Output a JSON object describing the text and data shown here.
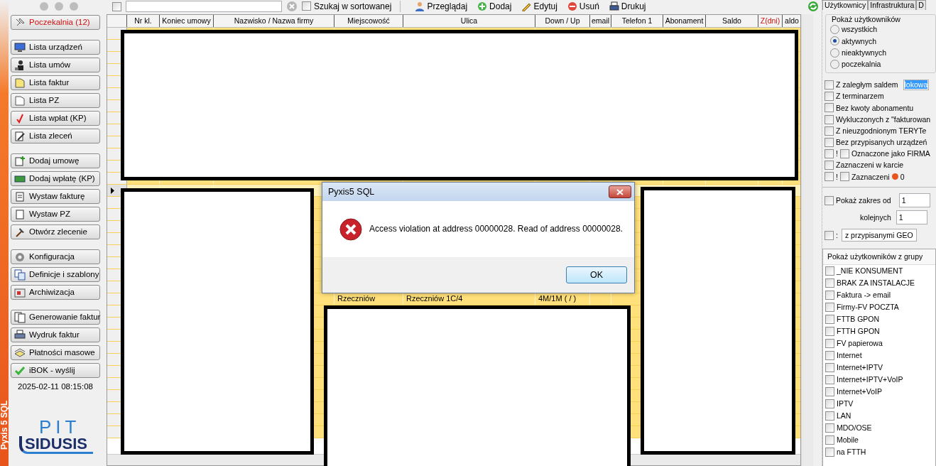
{
  "window": {
    "side_title": "Pyxis 5 SQL"
  },
  "sidebar": {
    "groups": [
      [
        {
          "label": "Poczekalnia (12)",
          "alert": true
        }
      ],
      [
        {
          "label": "Lista urządzeń",
          "alert": false
        },
        {
          "label": "Lista umów",
          "alert": false
        },
        {
          "label": "Lista faktur",
          "alert": false
        },
        {
          "label": "Lista PZ",
          "alert": false
        },
        {
          "label": "Lista wpłat (KP)",
          "alert": false
        },
        {
          "label": "Lista zleceń",
          "alert": false
        }
      ],
      [
        {
          "label": "Dodaj umowę",
          "alert": false
        },
        {
          "label": "Dodaj wpłatę (KP)",
          "alert": false
        },
        {
          "label": "Wystaw fakturę",
          "alert": false
        },
        {
          "label": "Wystaw PZ",
          "alert": false
        },
        {
          "label": "Otwórz zlecenie",
          "alert": false
        }
      ],
      [
        {
          "label": "Konfiguracja",
          "alert": false
        },
        {
          "label": "Definicje i szablony",
          "alert": false
        },
        {
          "label": "Archiwizacja",
          "alert": false
        }
      ],
      [
        {
          "label": "Generowanie faktur",
          "alert": false
        },
        {
          "label": "Wydruk faktur",
          "alert": false
        },
        {
          "label": "Płatności masowe",
          "alert": false
        },
        {
          "label": "iBOK - wyślij",
          "alert": false
        }
      ]
    ],
    "timestamp": "2025-02-11 08:15:08",
    "logo": {
      "top": "PIT",
      "bottom": "SIDUSIS"
    }
  },
  "toolbar": {
    "select_all": false,
    "search_sorted": {
      "label": "Szukaj w sortowanej",
      "checked": false
    },
    "actions": [
      {
        "label": "Przeglądaj"
      },
      {
        "label": "Dodaj"
      },
      {
        "label": "Edytuj"
      },
      {
        "label": "Usuń"
      },
      {
        "label": "Drukuj"
      }
    ]
  },
  "table": {
    "columns": [
      {
        "label": "Nr kl.",
        "alert": false
      },
      {
        "label": "Koniec umowy",
        "alert": false
      },
      {
        "label": "Nazwisko / Nazwa firmy",
        "alert": false
      },
      {
        "label": "Miejscowość",
        "alert": false
      },
      {
        "label": "Ulica",
        "alert": false
      },
      {
        "label": "Down / Up",
        "alert": false
      },
      {
        "label": "email",
        "alert": false
      },
      {
        "label": "Telefon 1",
        "alert": false
      },
      {
        "label": "Abonament",
        "alert": false
      },
      {
        "label": "Saldo",
        "alert": false
      },
      {
        "label": "Z(dni)",
        "alert": true
      },
      {
        "label": "aldo",
        "alert": false
      }
    ],
    "rows": [
      {
        "selected": false
      },
      {
        "selected": false
      },
      {
        "selected": false
      },
      {
        "selected": false
      },
      {
        "selected": false
      },
      {
        "selected": false
      },
      {
        "selected": false
      },
      {
        "selected": false
      },
      {
        "selected": false
      },
      {
        "selected": false
      },
      {
        "selected": false
      },
      {
        "selected": false
      },
      {
        "selected": false
      },
      {
        "selected": true
      },
      {
        "selected": false
      },
      {
        "selected": false
      },
      {
        "selected": false
      },
      {
        "selected": false
      },
      {
        "selected": false
      },
      {
        "selected": false
      },
      {
        "selected": false
      },
      {
        "selected": false
      },
      {
        "selected": false,
        "cells": [
          "",
          "",
          "",
          "Rzeczniów",
          "Rzeczniów 1C/4",
          "4M/1M ( / )"
        ]
      },
      {
        "selected": false
      },
      {
        "selected": false
      },
      {
        "selected": false
      },
      {
        "selected": false
      },
      {
        "selected": false
      },
      {
        "selected": false
      },
      {
        "selected": false
      },
      {
        "selected": false
      },
      {
        "selected": false
      },
      {
        "selected": false
      },
      {
        "selected": false
      }
    ]
  },
  "dialog": {
    "title": "Pyxis5 SQL",
    "message": "Access violation at address 00000028. Read of address 00000028.",
    "button": "OK"
  },
  "filters": {
    "tabs": [
      {
        "label": "Użytkownicy",
        "selected": true
      },
      {
        "label": "Infrastruktura",
        "selected": false
      },
      {
        "label": "D",
        "selected": false
      }
    ],
    "show_group": {
      "title": "Pokaż użytkowników",
      "options": [
        {
          "label": "wszystkich",
          "selected": false
        },
        {
          "label": "aktywnych",
          "selected": true
        },
        {
          "label": "nieaktywnych",
          "selected": false
        },
        {
          "label": "poczekalnia",
          "selected": false
        }
      ]
    },
    "checks": [
      {
        "kind": "field",
        "label": "Z zaległym saldem",
        "checked": false,
        "value": "lokowa"
      },
      {
        "kind": "plain",
        "label": "Z terminarzem",
        "checked": false
      },
      {
        "kind": "plain",
        "label": "Bez kwoty abonamentu",
        "checked": false
      },
      {
        "kind": "plain",
        "label": "Wykluczonych z \"fakturowan",
        "checked": false
      },
      {
        "kind": "plain",
        "label": "Z nieuzgodnionym TERYTe",
        "checked": false
      },
      {
        "kind": "plain",
        "label": "Bez przypisanych urządzeń",
        "checked": false
      },
      {
        "kind": "negated",
        "mark": "!",
        "label": "Oznaczone jako FIRMA",
        "checked": false,
        "inner_checked": false
      },
      {
        "kind": "plain",
        "label": "Zaznaczeni w karcie",
        "checked": false
      },
      {
        "kind": "counter",
        "mark": "!",
        "label": "Zaznaczeni",
        "checked": false,
        "inner_checked": false,
        "color": "#e8541c",
        "count": "0"
      }
    ],
    "range": {
      "checked": false,
      "from_label": "Pokaż zakres od",
      "from": "1",
      "count_label": "kolejnych",
      "count": "1"
    },
    "geo": {
      "checked": false,
      "mark": ":",
      "value": "z przypisanymi GEO"
    },
    "groups": {
      "title": "Pokaż użytkowników z grupy",
      "items": [
        {
          "label": "_NIE KONSUMENT",
          "checked": false
        },
        {
          "label": "BRAK ZA INSTALACJE",
          "checked": false
        },
        {
          "label": "Faktura -> email",
          "checked": false
        },
        {
          "label": "Firmy-FV POCZTA",
          "checked": false
        },
        {
          "label": "FTTB GPON",
          "checked": false
        },
        {
          "label": "FTTH GPON",
          "checked": false
        },
        {
          "label": "FV papierowa",
          "checked": false
        },
        {
          "label": "Internet",
          "checked": false
        },
        {
          "label": "Internet+IPTV",
          "checked": false
        },
        {
          "label": "Internet+IPTV+VoIP",
          "checked": false
        },
        {
          "label": "Internet+VoIP",
          "checked": false
        },
        {
          "label": "IPTV",
          "checked": false
        },
        {
          "label": "LAN",
          "checked": false
        },
        {
          "label": "MDO/OSE",
          "checked": false
        },
        {
          "label": "Mobile",
          "checked": false
        },
        {
          "label": "na FTTH",
          "checked": false
        }
      ]
    }
  }
}
